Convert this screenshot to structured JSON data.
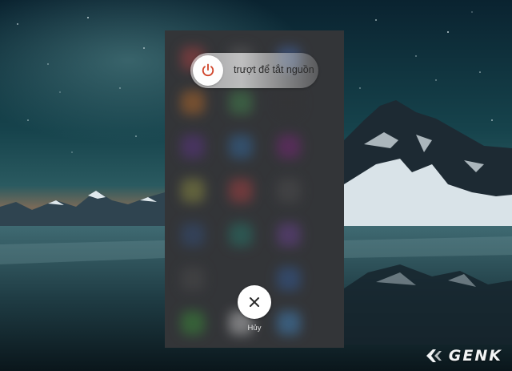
{
  "power_menu": {
    "slider_label": "trượt để tắt nguồn",
    "cancel_label": "Hủy",
    "power_icon": "power-icon",
    "cancel_icon": "close-icon"
  },
  "watermark": {
    "text": "GENK"
  },
  "colors": {
    "power_icon": "#d0452b",
    "panel": "#393b3e",
    "sky": "#0f3540"
  }
}
